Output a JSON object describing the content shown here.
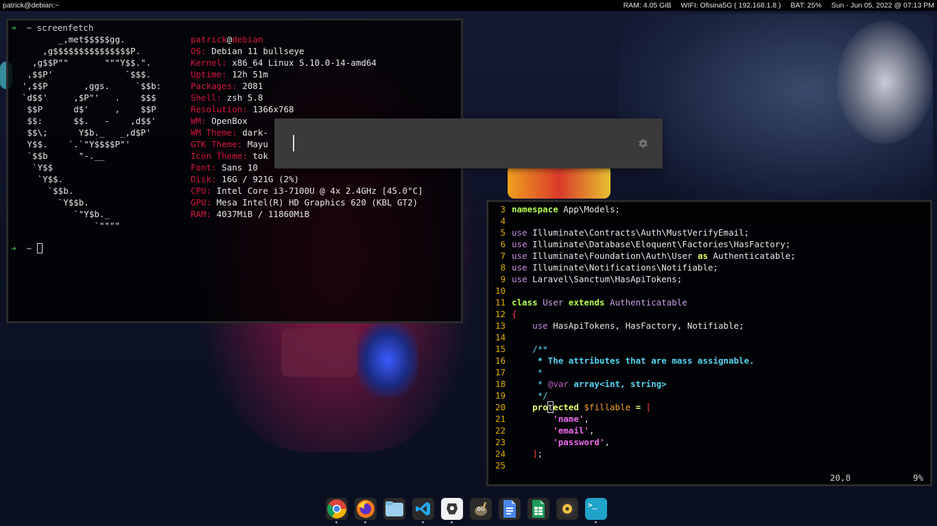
{
  "topbar": {
    "title": "patrick@debian:~",
    "ram": "RAM: 4.05 GiB",
    "wifi": "WIFI: Ofisina5G ( 192.168.1.8 )",
    "battery": "BAT: 25%",
    "datetime": "Sun - Jun 05, 2022 @ 07:13 PM"
  },
  "terminal": {
    "prompt_arrow": "➜",
    "prompt_dir": "~",
    "command": "screenfetch",
    "ascii": [
      "       _,met$$$$$gg.",
      "    ,g$$$$$$$$$$$$$$$P.",
      "  ,g$$P\"\"       \"\"\"Y$$.\".",
      " ,$$P'              `$$$.",
      "',$$P       ,ggs.     `$$b:",
      "`d$$'     ,$P\"'   .    $$$",
      " $$P      d$'     ,    $$P",
      " $$:      $$.   -    ,d$$'",
      " $$\\;      Y$b._   _,d$P'",
      " Y$$.    `.`\"Y$$$$P\"'",
      " `$$b      \"-.__",
      "  `Y$$",
      "   `Y$$.",
      "     `$$b.",
      "       `Y$$b.",
      "          `\"Y$b._",
      "              `\"\"\"\""
    ],
    "user": "patrick",
    "at": "@",
    "host": "debian",
    "info": [
      {
        "key": "OS:",
        "value": "Debian 11 bullseye"
      },
      {
        "key": "Kernel:",
        "value": "x86_64 Linux 5.10.0-14-amd64"
      },
      {
        "key": "Uptime:",
        "value": "12h 51m"
      },
      {
        "key": "Packages:",
        "value": "2081"
      },
      {
        "key": "Shell:",
        "value": "zsh 5.8"
      },
      {
        "key": "Resolution:",
        "value": "1366x768"
      },
      {
        "key": "WM:",
        "value": "OpenBox"
      },
      {
        "key": "WM Theme:",
        "value": "dark-"
      },
      {
        "key": "GTK Theme:",
        "value": "Mayu"
      },
      {
        "key": "Icon Theme:",
        "value": "tok"
      },
      {
        "key": "Font:",
        "value": "Sans 10"
      },
      {
        "key": "Disk:",
        "value": "16G / 921G (2%)"
      },
      {
        "key": "CPU:",
        "value": "Intel Core i3-7100U @ 4x 2.4GHz [45.0°C]"
      },
      {
        "key": "GPU:",
        "value": "Mesa Intel(R) HD Graphics 620 (KBL GT2)"
      },
      {
        "key": "RAM:",
        "value": "4037MiB / 11860MiB"
      }
    ]
  },
  "launcher": {
    "value": "",
    "settings_icon": "gear-icon"
  },
  "vim": {
    "lines": [
      {
        "n": "3",
        "parts": [
          [
            "kw",
            "namespace"
          ],
          [
            "ident",
            " App\\Models;"
          ]
        ]
      },
      {
        "n": "4",
        "parts": []
      },
      {
        "n": "5",
        "parts": [
          [
            "use",
            "use"
          ],
          [
            "ident",
            " Illuminate\\Contracts\\Auth\\MustVerifyEmail;"
          ]
        ]
      },
      {
        "n": "6",
        "parts": [
          [
            "use",
            "use"
          ],
          [
            "ident",
            " Illuminate\\Database\\Eloquent\\Factories\\HasFactory;"
          ]
        ]
      },
      {
        "n": "7",
        "parts": [
          [
            "use",
            "use"
          ],
          [
            "ident",
            " Illuminate\\Foundation\\Auth\\User "
          ],
          [
            "kwy",
            "as"
          ],
          [
            "ident",
            " Authenticatable;"
          ]
        ]
      },
      {
        "n": "8",
        "parts": [
          [
            "use",
            "use"
          ],
          [
            "ident",
            " Illuminate\\Notifications\\Notifiable;"
          ]
        ]
      },
      {
        "n": "9",
        "parts": [
          [
            "use",
            "use"
          ],
          [
            "ident",
            " Laravel\\Sanctum\\HasApiTokens;"
          ]
        ]
      },
      {
        "n": "10",
        "parts": []
      },
      {
        "n": "11",
        "parts": [
          [
            "kw",
            "class"
          ],
          [
            "cls",
            " User "
          ],
          [
            "kw",
            "extends"
          ],
          [
            "cls",
            " Authenticatable"
          ]
        ]
      },
      {
        "n": "12",
        "parts": [
          [
            "par",
            "{"
          ]
        ]
      },
      {
        "n": "13",
        "parts": [
          [
            "ident",
            "    "
          ],
          [
            "use",
            "use"
          ],
          [
            "ident",
            " HasApiTokens, HasFactory, Notifiable;"
          ]
        ]
      },
      {
        "n": "14",
        "parts": []
      },
      {
        "n": "15",
        "parts": [
          [
            "cmt",
            "    /**"
          ]
        ]
      },
      {
        "n": "16",
        "parts": [
          [
            "cmtb",
            "     * The attributes that are mass assignable."
          ]
        ]
      },
      {
        "n": "17",
        "parts": [
          [
            "cmt",
            "     *"
          ]
        ]
      },
      {
        "n": "18",
        "parts": [
          [
            "cmt",
            "     * "
          ],
          [
            "tag",
            "@var"
          ],
          [
            "cmtb",
            " array<int, string>"
          ]
        ]
      },
      {
        "n": "19",
        "parts": [
          [
            "cmt",
            "     */"
          ]
        ]
      },
      {
        "n": "20",
        "parts": [
          [
            "kwy",
            "    pro"
          ],
          [
            "cur",
            "t"
          ],
          [
            "kwy",
            "ected"
          ],
          [
            "ident",
            " "
          ],
          [
            "var",
            "$fillable"
          ],
          [
            "ident",
            " "
          ],
          [
            "kwy",
            "="
          ],
          [
            "ident",
            " "
          ],
          [
            "par",
            "["
          ]
        ]
      },
      {
        "n": "21",
        "parts": [
          [
            "ident",
            "        "
          ],
          [
            "str",
            "'name'"
          ],
          [
            "ident",
            ","
          ]
        ]
      },
      {
        "n": "22",
        "parts": [
          [
            "ident",
            "        "
          ],
          [
            "str",
            "'email'"
          ],
          [
            "ident",
            ","
          ]
        ]
      },
      {
        "n": "23",
        "parts": [
          [
            "ident",
            "        "
          ],
          [
            "str",
            "'password'"
          ],
          [
            "ident",
            ","
          ]
        ]
      },
      {
        "n": "24",
        "parts": [
          [
            "ident",
            "    "
          ],
          [
            "par",
            "]"
          ],
          [
            "ident",
            ";"
          ]
        ]
      },
      {
        "n": "25",
        "parts": []
      }
    ],
    "position": "20,8",
    "percent": "9%"
  },
  "dock": [
    {
      "name": "chrome-icon",
      "label": ""
    },
    {
      "name": "firefox-icon",
      "label": ""
    },
    {
      "name": "file-manager-icon",
      "label": ""
    },
    {
      "name": "vscode-icon",
      "label": ""
    },
    {
      "name": "beekeeper-icon",
      "label": ""
    },
    {
      "name": "gimp-icon",
      "label": ""
    },
    {
      "name": "document-viewer-icon",
      "label": ""
    },
    {
      "name": "spreadsheet-icon",
      "label": ""
    },
    {
      "name": "music-player-icon",
      "label": ""
    },
    {
      "name": "terminal-icon",
      "label": ">_"
    }
  ]
}
